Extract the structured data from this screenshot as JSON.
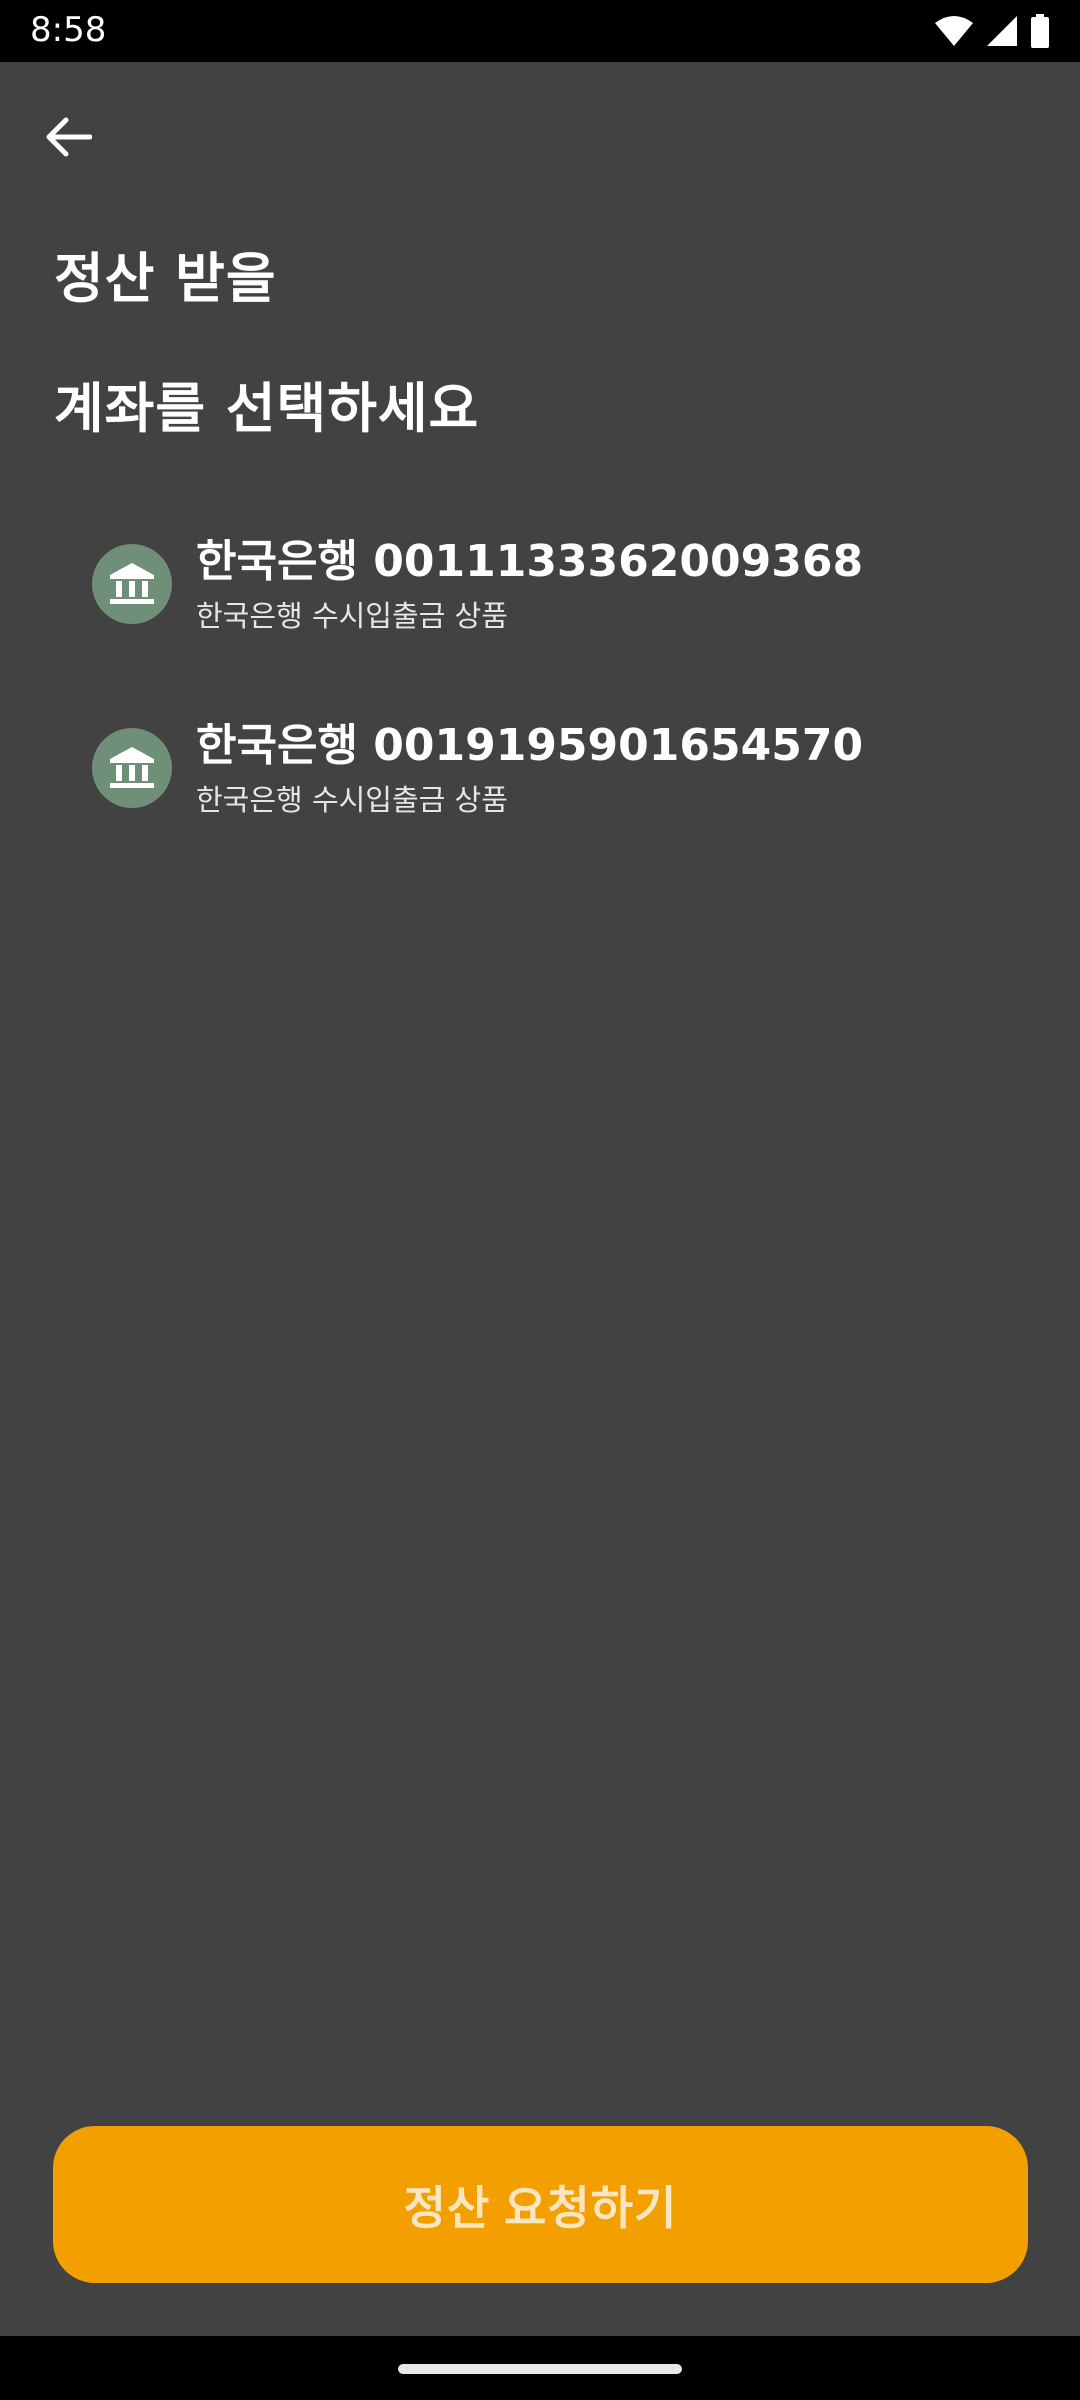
{
  "status_bar": {
    "time": "8:58",
    "icons": [
      "wifi-icon",
      "cell-signal-icon",
      "battery-icon"
    ]
  },
  "header": {
    "back_icon": "arrow-left-icon"
  },
  "title": "정산 받을\n계좌를 선택하세요",
  "accounts": [
    {
      "name": "한국은행 0011133362009368",
      "description": "한국은행 수시입출금 상품",
      "icon": "bank-icon"
    },
    {
      "name": "한국은행 0019195901654570",
      "description": "한국은행 수시입출금 상품",
      "icon": "bank-icon"
    }
  ],
  "action": {
    "request_label": "정산 요청하기"
  },
  "colors": {
    "background": "#424242",
    "accent": "#f49f00",
    "bank_icon_bg": "#6f8f78"
  }
}
